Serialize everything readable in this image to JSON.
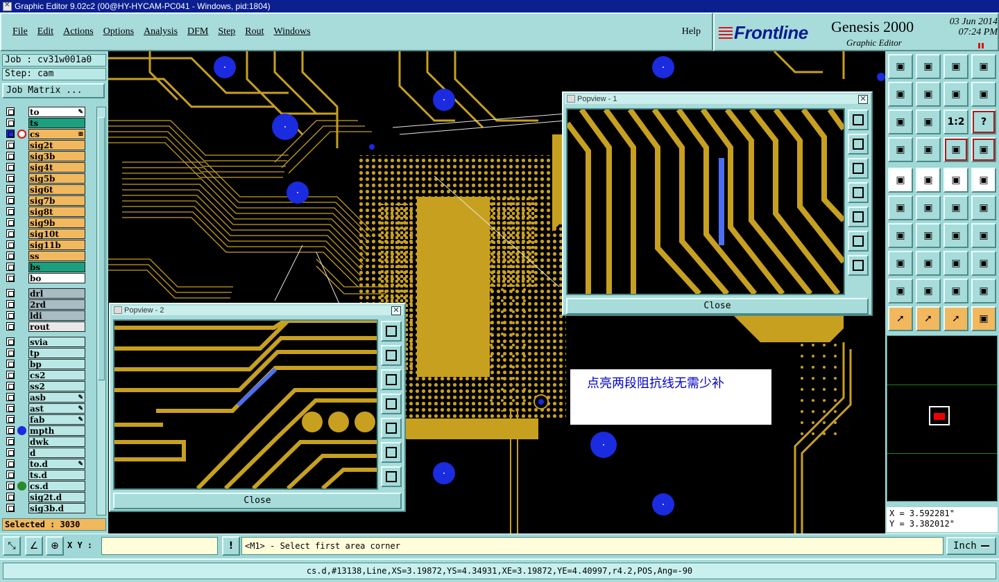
{
  "window": {
    "title": "Graphic Editor 9.02c2 (00@HY-HYCAM-PC041 - Windows, pid:1804)"
  },
  "menu": {
    "items": [
      {
        "label": "File"
      },
      {
        "label": "Edit"
      },
      {
        "label": "Actions"
      },
      {
        "label": "Options"
      },
      {
        "label": "Analysis"
      },
      {
        "label": "DFM"
      },
      {
        "label": "Step"
      },
      {
        "label": "Rout"
      },
      {
        "label": "Windows"
      }
    ],
    "help": "Help"
  },
  "brand": {
    "logo": "Frontline",
    "product": "Genesis 2000",
    "subtitle": "Graphic Editor",
    "date": "03 Jun 2014",
    "time": "07:24 PM"
  },
  "job": {
    "job_label": "Job : cv31w001a0",
    "step_label": "Step: cam",
    "matrix_button": "Job Matrix ..."
  },
  "layers": [
    {
      "name": "to",
      "color": "#ffffff",
      "mark": "✎"
    },
    {
      "name": "ts",
      "color": "#1aa07e"
    },
    {
      "name": "cs",
      "color": "#f2b85e",
      "mark": "⊞",
      "active": true
    },
    {
      "name": "sig2t",
      "color": "#f2b85e"
    },
    {
      "name": "sig3b",
      "color": "#f2b85e"
    },
    {
      "name": "sig4t",
      "color": "#f2b85e"
    },
    {
      "name": "sig5b",
      "color": "#f2b85e"
    },
    {
      "name": "sig6t",
      "color": "#f2b85e"
    },
    {
      "name": "sig7b",
      "color": "#f2b85e"
    },
    {
      "name": "sig8t",
      "color": "#f2b85e"
    },
    {
      "name": "sig9b",
      "color": "#f2b85e"
    },
    {
      "name": "sig10t",
      "color": "#f2b85e"
    },
    {
      "name": "sig11b",
      "color": "#f2b85e"
    },
    {
      "name": "ss",
      "color": "#f2b85e"
    },
    {
      "name": "bs",
      "color": "#1aa07e"
    },
    {
      "name": "bo",
      "color": "#ffffff"
    },
    {
      "name": "drl",
      "color": "#a9bcc4",
      "gap": true
    },
    {
      "name": "2rd",
      "color": "#a9bcc4"
    },
    {
      "name": "ldi",
      "color": "#a9bcc4"
    },
    {
      "name": "rout",
      "color": "#e8e8e8"
    },
    {
      "name": "svia",
      "color": "#b9e8e6",
      "gap": true
    },
    {
      "name": "tp",
      "color": "#b9e8e6"
    },
    {
      "name": "bp",
      "color": "#b9e8e6"
    },
    {
      "name": "cs2",
      "color": "#b9e8e6"
    },
    {
      "name": "ss2",
      "color": "#b9e8e6"
    },
    {
      "name": "asb",
      "color": "#b9e8e6",
      "mark": "✎"
    },
    {
      "name": "ast",
      "color": "#b9e8e6",
      "mark": "✎"
    },
    {
      "name": "fab",
      "color": "#b9e8e6",
      "mark": "✎"
    },
    {
      "name": "mpth",
      "color": "#b9e8e6",
      "dot": "#1b2be0"
    },
    {
      "name": "dwk",
      "color": "#b9e8e6"
    },
    {
      "name": "d",
      "color": "#b9e8e6"
    },
    {
      "name": "to.d",
      "color": "#b9e8e6",
      "mark": "✎"
    },
    {
      "name": "ts.d",
      "color": "#b9e8e6"
    },
    {
      "name": "cs.d",
      "color": "#b9e8e6",
      "dot": "#2a8a2a"
    },
    {
      "name": "sig2t.d",
      "color": "#b9e8e6"
    },
    {
      "name": "sig3b.d",
      "color": "#b9e8e6"
    }
  ],
  "selected": "Selected : 3030",
  "popview1": {
    "title": "Popview - 1",
    "close": "Close"
  },
  "popview2": {
    "title": "Popview - 2",
    "close": "Close"
  },
  "note": "点亮两段阻抗线无需少补",
  "coords": {
    "x": "X = 3.592281\"",
    "y": "Y = 3.382012\""
  },
  "bottom": {
    "xy_label": "X Y :",
    "xy_value": "",
    "prompt": "<M1> - Select first area corner",
    "unit": "Inch"
  },
  "status": "cs.d,#13138,Line,XS=3.19872,YS=4.34931,XE=3.19872,YE=4.40997,r4.2,POS,Ang=-90",
  "colors": {
    "copper": "#c8a020",
    "pad_blue": "#1b2be0",
    "bg": "#000000"
  }
}
